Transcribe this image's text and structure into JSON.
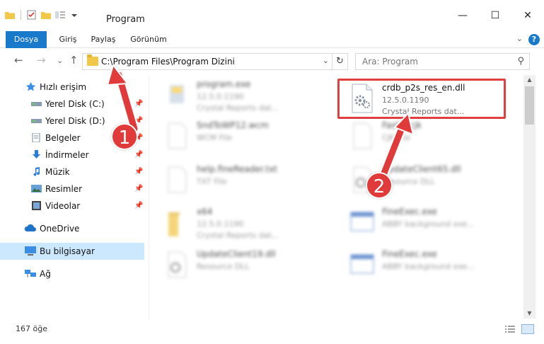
{
  "window": {
    "title": "Program",
    "minimize_glyph": "—",
    "maximize_glyph": "☐",
    "close_glyph": "✕"
  },
  "ribbon": {
    "tabs": [
      "Dosya",
      "Giriş",
      "Paylaş",
      "Görünüm"
    ],
    "help_glyph": "?",
    "collapse_glyph": "⌄"
  },
  "nav": {
    "back": "←",
    "forward": "→",
    "recent": "⌄",
    "up": "↑"
  },
  "address": {
    "path": "C:\\Program Files\\Program Dizini",
    "dropdown_glyph": "⌄",
    "refresh_glyph": "↻"
  },
  "search": {
    "placeholder": "Ara: Program",
    "icon_glyph": "⚲"
  },
  "sidebar": {
    "pin_glyph": "📌",
    "items": [
      {
        "label": "Hızlı erişim",
        "icon": "star-icon"
      },
      {
        "label": "Yerel Disk (C:)",
        "icon": "drive-icon"
      },
      {
        "label": "Yerel Disk (D:)",
        "icon": "drive-icon"
      },
      {
        "label": "Belgeler",
        "icon": "document-icon"
      },
      {
        "label": "İndirmeler",
        "icon": "download-icon"
      },
      {
        "label": "Müzik",
        "icon": "music-icon"
      },
      {
        "label": "Resimler",
        "icon": "pictures-icon"
      },
      {
        "label": "Videolar",
        "icon": "video-icon"
      },
      {
        "label": "OneDrive",
        "icon": "cloud-icon"
      },
      {
        "label": "Bu bilgisayar",
        "icon": "computer-icon"
      },
      {
        "label": "Ağ",
        "icon": "network-icon"
      }
    ]
  },
  "files": [
    {
      "name": "program.exe",
      "line2": "12.5.0.1190",
      "line3": "Crystal Reports dat..."
    },
    {
      "name": "crdb_p2s_res_en.dll",
      "line2": "12.5.0.1190",
      "line3": "Crystal Reports dat..."
    },
    {
      "name": "SndToWP12.wcm",
      "line2": "WCM File",
      "line3": ""
    },
    {
      "name": "FastIn.cjk",
      "line2": "CJK File",
      "line3": ""
    },
    {
      "name": "help.fineReader.txt",
      "line2": "TXT File",
      "line3": ""
    },
    {
      "name": "UpdateClient65.dll",
      "line2": "Resource DLL",
      "line3": ""
    },
    {
      "name": "x64",
      "line2": "12.5.0.1190",
      "line3": "Crystal Reports dat..."
    },
    {
      "name": "FineExec.exe",
      "line2": "ABBY background exe...",
      "line3": ""
    },
    {
      "name": "UpdateClient19.dll",
      "line2": "Resource DLL",
      "line3": ""
    },
    {
      "name": "FineExec.exe",
      "line2": "ABBY background exe...",
      "line3": ""
    }
  ],
  "status": {
    "count_text": "167 öğe"
  },
  "callouts": [
    "1",
    "2"
  ],
  "colors": {
    "accent": "#1979ca",
    "highlight": "#e04040",
    "selected": "#cce8ff"
  }
}
